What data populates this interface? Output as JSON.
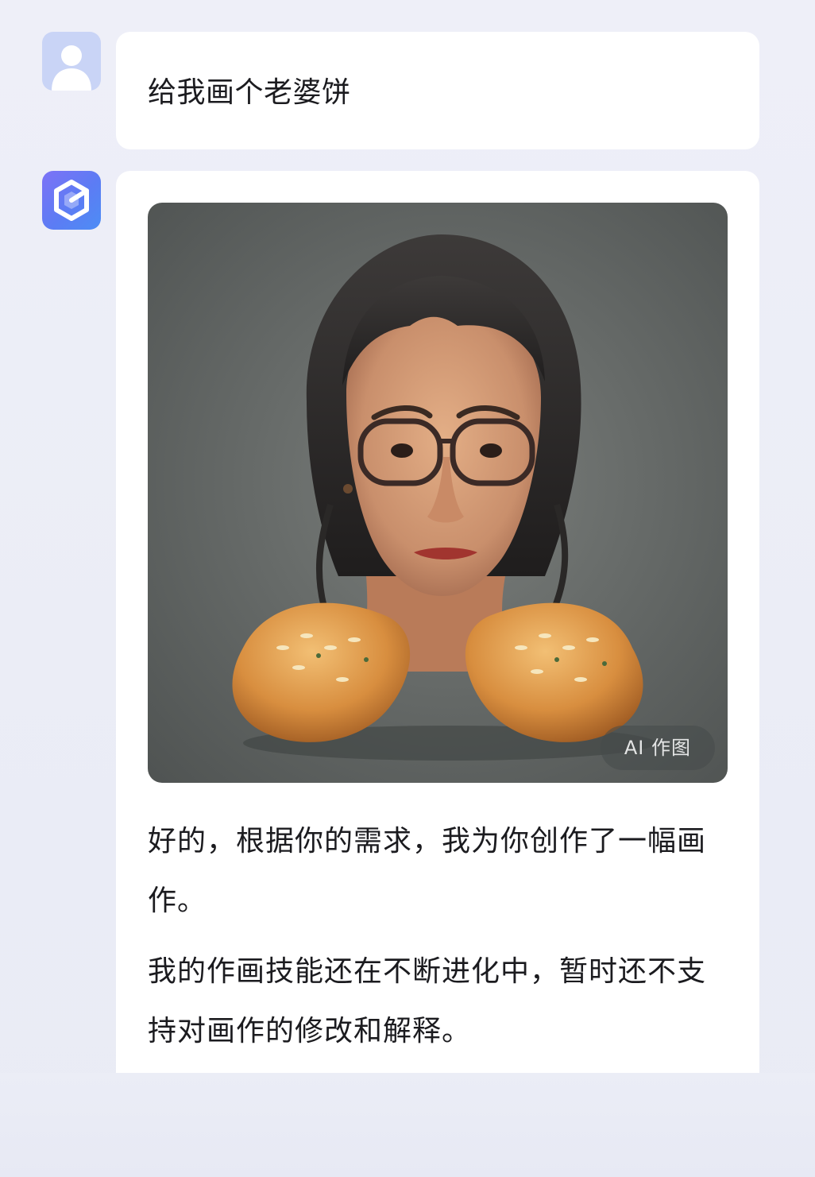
{
  "colors": {
    "bot_avatar_gradient": [
      "#7d72f6",
      "#4d8df5"
    ],
    "user_avatar": "#c9d4f6",
    "bubble_bg": "#ffffff",
    "page_bg": "#eceef7"
  },
  "user_message": {
    "avatar_icon": "user-silhouette-icon",
    "text": "给我画个老婆饼"
  },
  "bot_message": {
    "avatar_icon": "hexagon-logo-icon",
    "image": {
      "description_icon": "generated-artwork-image",
      "badge": "AI 作图"
    },
    "paragraphs": [
      "好的，根据你的需求，我为你创作了一幅画作。",
      "我的作画技能还在不断进化中，暂时还不支持对画作的修改和解释。"
    ]
  }
}
